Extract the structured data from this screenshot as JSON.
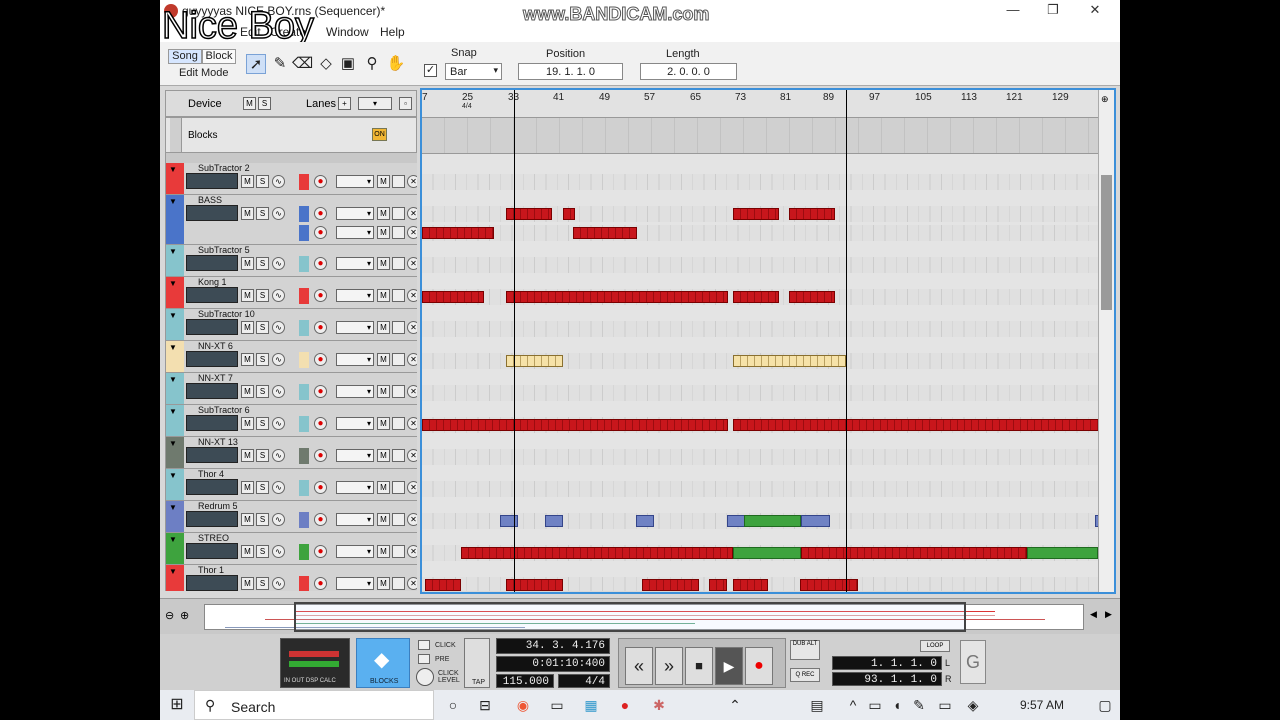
{
  "window": {
    "title": "guyyyyas NICE BOY.rns (Sequencer)*",
    "minimize": "—",
    "maximize": "❐",
    "close": "✕"
  },
  "overlays": {
    "watermark": "www.BANDICAM.com",
    "caption": "Nice Boy"
  },
  "menu": {
    "items": [
      "Edit",
      "Create",
      "Window",
      "Help"
    ]
  },
  "toolbar": {
    "song": "Song",
    "block": "Block",
    "edit_mode": "Edit Mode",
    "snap_label": "Snap",
    "snap_value": "Bar",
    "position_label": "Position",
    "position_value": "19.  1.  1.    0",
    "length_label": "Length",
    "length_value": "2.  0.  0.    0"
  },
  "sequencer": {
    "device_label": "Device",
    "lanes_label": "Lanes",
    "blocks_label": "Blocks",
    "blocks_on": "ON",
    "ruler_marks": [
      "7",
      "25",
      "33",
      "41",
      "49",
      "57",
      "65",
      "73",
      "81",
      "89",
      "97",
      "105",
      "113",
      "121",
      "129"
    ],
    "time_sig": "4/4",
    "tracks": [
      {
        "name": "SubTractor 2",
        "color": "#e83a3a"
      },
      {
        "name": "BASS",
        "color": "#4a74c9"
      },
      {
        "name": "SubTractor 5",
        "color": "#86c4cc"
      },
      {
        "name": "Kong 1",
        "color": "#e83a3a"
      },
      {
        "name": "SubTractor 10",
        "color": "#86c4cc"
      },
      {
        "name": "NN-XT 6",
        "color": "#f3dfb0"
      },
      {
        "name": "NN-XT 7",
        "color": "#86c4cc"
      },
      {
        "name": "SubTractor 6",
        "color": "#86c4cc"
      },
      {
        "name": "NN-XT 13",
        "color": "#6f7a6e"
      },
      {
        "name": "Thor 4",
        "color": "#86c4cc"
      },
      {
        "name": "Redrum 5",
        "color": "#6d7fc4"
      },
      {
        "name": "STREO",
        "color": "#3ea33e"
      },
      {
        "name": "Thor 1",
        "color": "#e83a3a"
      }
    ]
  },
  "transport": {
    "position": "34.  3.  4.176",
    "time": "0:01:10:400",
    "tempo": "115.000",
    "signature": "4/4",
    "left_loc": "1.  1.  1.    0",
    "right_loc": "93.  1.  1.    0",
    "click": "CLICK",
    "pre": "PRE",
    "click_level": "CLICK LEVEL",
    "tap": "TAP",
    "blocks": "BLOCKS",
    "dub": "DUB",
    "alt": "ALT",
    "q_rec": "Q REC",
    "loop": "LOOP",
    "l": "L",
    "r": "R",
    "meter_labels": "IN  OUT  DSP  CALC"
  },
  "taskbar": {
    "search_placeholder": "Search",
    "clock": "9:57 AM"
  }
}
